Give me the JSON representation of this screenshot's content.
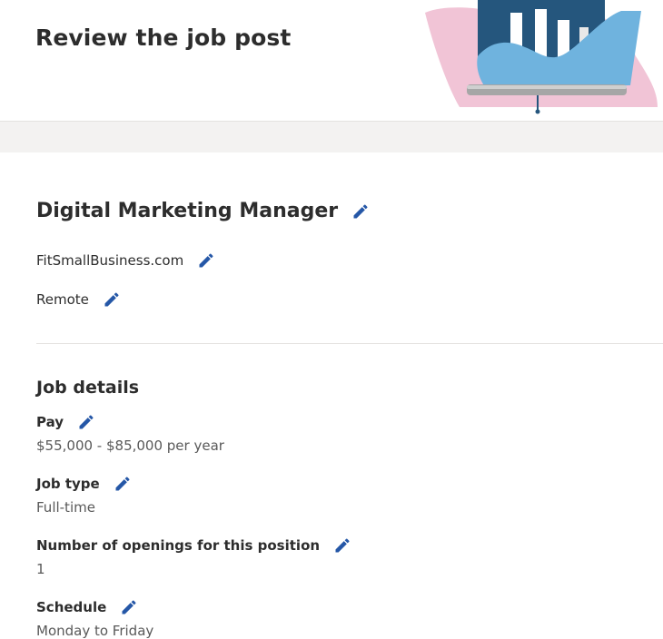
{
  "header": {
    "title": "Review the job post"
  },
  "job": {
    "title": "Digital Marketing Manager",
    "company": "FitSmallBusiness.com",
    "location": "Remote"
  },
  "details": {
    "heading": "Job details",
    "fields": [
      {
        "label": "Pay",
        "value": "$55,000 - $85,000 per year"
      },
      {
        "label": "Job type",
        "value": "Full-time"
      },
      {
        "label": "Number of openings for this position",
        "value": "1"
      },
      {
        "label": "Schedule",
        "value": "Monday to Friday"
      }
    ]
  },
  "colors": {
    "accent": "#2557a7",
    "illustration_pink": "#f1c4d6",
    "illustration_blue": "#6fb3de",
    "illustration_navy": "#25567d"
  },
  "icons": {
    "edit": "pencil-icon"
  }
}
